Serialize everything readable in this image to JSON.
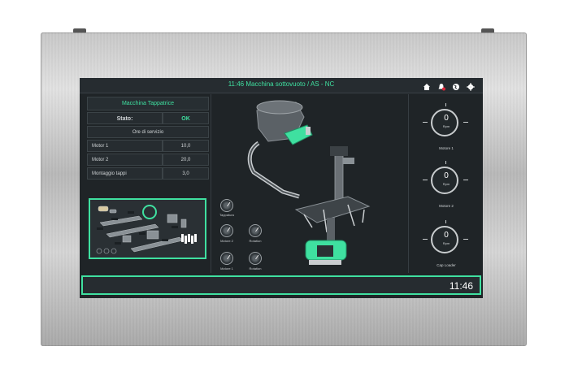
{
  "header": {
    "title": "11:46 Macchina sottovuoto / AS - NC",
    "icons": [
      "home-icon",
      "alarm-icon",
      "globe-icon",
      "gear-icon"
    ]
  },
  "machine_panel": {
    "title": "Macchina Tappatrice",
    "status_label": "Stato:",
    "status_value": "OK",
    "service_hours_label": "Ore di servizio",
    "rows": [
      {
        "label": "Motor 1",
        "value": "10,0"
      },
      {
        "label": "Motor 2",
        "value": "20,0"
      },
      {
        "label": "Montaggio tappi",
        "value": "3,0"
      }
    ]
  },
  "small_gauges": [
    {
      "label": "Tappatura"
    },
    {
      "label": "Motore 2"
    },
    {
      "label": "Rotation"
    },
    {
      "label": "Motore 1"
    },
    {
      "label": "Rotation"
    }
  ],
  "rpm_gauges": [
    {
      "value": "0",
      "unit": "Rpm",
      "name": "Motore 1"
    },
    {
      "value": "0",
      "unit": "Rpm",
      "name": "Motore 2"
    },
    {
      "value": "0",
      "unit": "Rpm",
      "name": "Cap Loader"
    }
  ],
  "footer": {
    "clock": "11:46"
  },
  "colors": {
    "accent": "#3fe0a0",
    "screen_bg": "#1f2427",
    "frame": "#c9c9c9"
  }
}
